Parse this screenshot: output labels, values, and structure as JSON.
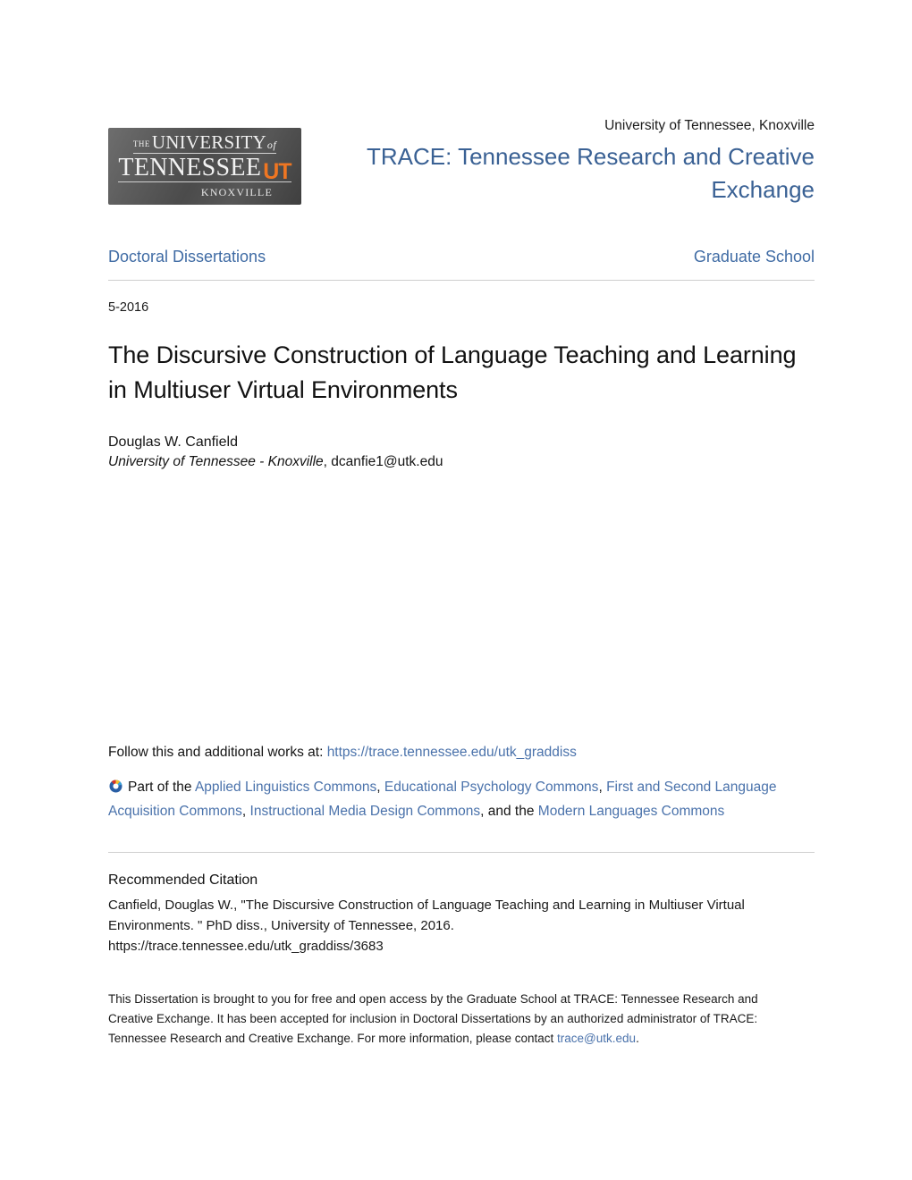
{
  "masthead": {
    "logo": {
      "the": "THE",
      "university": "UNIVERSITY",
      "of": "of",
      "tennessee": "TENNESSEE",
      "ut_mark": "UT",
      "knoxville": "KNOXVILLE",
      "alt": "The University of Tennessee, Knoxville logo"
    },
    "institution": "University of Tennessee, Knoxville",
    "repository_title": "TRACE: Tennessee Research and Creative Exchange"
  },
  "nav": {
    "collection": "Doctoral Dissertations",
    "unit": "Graduate School"
  },
  "record": {
    "date": "5-2016",
    "title": "The Discursive Construction of Language Teaching and Learning in Multiuser Virtual Environments",
    "author_name": "Douglas W. Canfield",
    "author_affiliation": "University of Tennessee - Knoxville",
    "author_affiliation_sep": ",",
    "author_email": "dcanfie1@utk.edu"
  },
  "follow": {
    "prefix": "Follow this and additional works at:",
    "url": "https://trace.tennessee.edu/utk_graddiss",
    "icon_name": "digital-commons-network-icon",
    "part_of_prefix": "Part of the",
    "commons": [
      "Applied Linguistics Commons",
      "Educational Psychology Commons",
      "First and Second Language Acquisition Commons",
      "Instructional Media Design Commons",
      "Modern Languages Commons"
    ],
    "separator": ",",
    "and_the": "and the"
  },
  "citation": {
    "heading": "Recommended Citation",
    "text": "Canfield, Douglas W., \"The Discursive Construction of Language Teaching and Learning in Multiuser Virtual Environments. \" PhD diss., University of Tennessee, 2016.",
    "url": "https://trace.tennessee.edu/utk_graddiss/3683"
  },
  "footer": {
    "text_before_email": "This Dissertation is brought to you for free and open access by the Graduate School at TRACE: Tennessee Research and Creative Exchange. It has been accepted for inclusion in Doctoral Dissertations by an authorized administrator of TRACE: Tennessee Research and Creative Exchange. For more information, please contact",
    "email": "trace@utk.edu",
    "period": "."
  },
  "colors": {
    "heading_blue": "#3a6194",
    "link_blue": "#4a72ab",
    "nav_blue": "#3f6ba4",
    "ut_orange": "#ef7622",
    "rule_gray": "#cfcfcf",
    "logo_dark": "#4b4b4b"
  }
}
